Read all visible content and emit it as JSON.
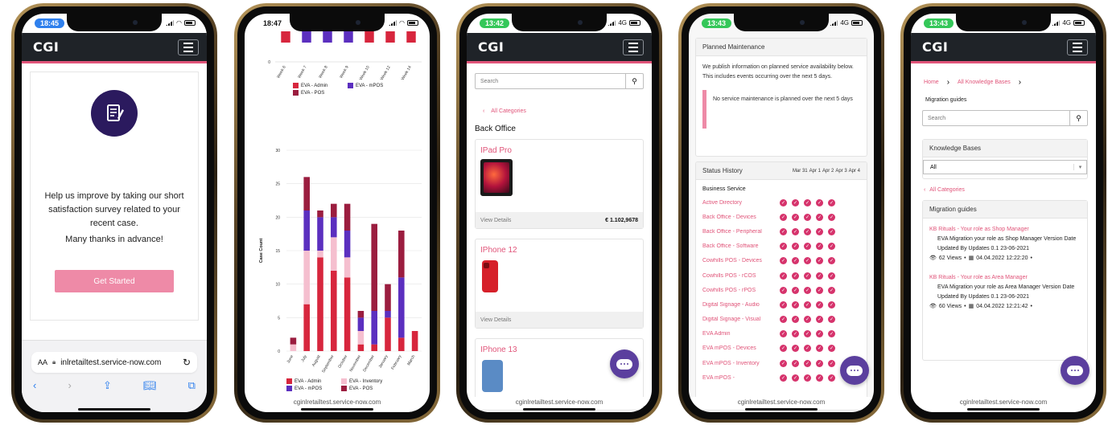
{
  "phones": [
    {
      "time": "18:45",
      "logo": "CGI",
      "survey": {
        "message": "Help us improve by taking our short satisfaction survey related to your recent case.",
        "thanks": "Many thanks in advance!",
        "button": "Get Started"
      },
      "browser": {
        "aa": "AA",
        "url": "inlretailtest.service-now.com"
      },
      "icons": [
        "document-icon",
        "lock-icon",
        "reload-icon",
        "back-arrow-icon",
        "forward-arrow-icon",
        "share-icon",
        "book-icon",
        "tabs-icon"
      ]
    },
    {
      "time": "18:47",
      "footer_url": "cginlretailtest.service-now.com"
    },
    {
      "time": "13:42",
      "network": "4G",
      "logo": "CGI",
      "search_placeholder": "Search",
      "back_link": "All Categories",
      "section_title": "Back Office",
      "items": [
        {
          "name": "IPad Pro",
          "view_details": "View Details",
          "price": "€ 1.102,9678"
        },
        {
          "name": "IPhone 12",
          "view_details": "View Details",
          "price": ""
        },
        {
          "name": "IPhone 13"
        }
      ],
      "footer_url": "cginlretailtest.service-now.com"
    },
    {
      "time": "13:43",
      "network": "4G",
      "planned": {
        "title": "Planned Maintenance",
        "text": "We publish information on planned service availability below. This includes events occurring over the next 5 days.",
        "notice": "No service maintenance is planned over the next 5 days"
      },
      "status": {
        "title": "Status History",
        "dates": [
          "Mar 31",
          "Apr 1",
          "Apr 2",
          "Apr 3",
          "Apr 4"
        ],
        "group": "Business Service",
        "services": [
          "Active Directory",
          "Back Office - Devices",
          "Back Office - Peripheral",
          "Back Office - Software",
          "Cowhills POS - Devices",
          "Cowhills POS - rCOS",
          "Cowhills POS - rPOS",
          "Digital Signage - Audio",
          "Digital Signage - Visual",
          "EVA Admin",
          "EVA mPOS - Devices",
          "EVA mPOS - Inventory",
          "EVA mPOS -"
        ]
      },
      "footer_url": "cginlretailtest.service-now.com"
    },
    {
      "time": "13:43",
      "network": "4G",
      "logo": "CGI",
      "breadcrumb": [
        "Home",
        "All Knowledge Bases"
      ],
      "page_title": "Migration guides",
      "search_placeholder": "Search",
      "kb_panel_title": "Knowledge Bases",
      "kb_select": "All",
      "back_link": "All Categories",
      "guides_title": "Migration guides",
      "articles": [
        {
          "title": "KB Rituals - Your role as Shop Manager",
          "summary": "EVA Migration your role as Shop Manager Version Date Updated By Updates 0.1 23-06-2021",
          "views": "62 Views",
          "date": "04.04.2022 12:22:20"
        },
        {
          "title": "KB Rituals - Your role as Area Manager",
          "summary": "EVA Migration your role as Area Manager Version Date Updated By Updates 0.1 23-06-2021",
          "views": "60 Views",
          "date": "04.04.2022 12:21:42"
        }
      ],
      "footer_url": "cginlretailtest.service-now.com"
    }
  ],
  "chart_data": [
    {
      "type": "bar",
      "categories": [
        "Week 6",
        "Week 7",
        "Week 8",
        "Week 9",
        "Week 10",
        "Week 12",
        "Week 14"
      ],
      "series": [
        {
          "name": "EVA - Admin",
          "color": "#d7263d",
          "values": [
            null,
            null,
            null,
            null,
            null,
            null,
            null
          ]
        },
        {
          "name": "EVA - mPOS",
          "color": "#5b2fbf",
          "values": [
            null,
            null,
            null,
            null,
            null,
            null,
            null
          ]
        },
        {
          "name": "EVA - POS",
          "color": "#9b1d3f",
          "values": [
            null,
            null,
            null,
            null,
            null,
            null,
            null
          ]
        }
      ],
      "bar_colors": [
        "#d7263d",
        "#5b2fbf",
        "#5b2fbf",
        "#5b2fbf",
        "#d7263d",
        "#d7263d",
        "#d7263d"
      ],
      "y_visible_tick": "0",
      "legend": "bottom"
    },
    {
      "type": "bar",
      "stacked": true,
      "ylabel": "Case Count",
      "ylim": [
        0,
        30
      ],
      "yticks": [
        "0",
        "5",
        "10",
        "15",
        "20",
        "25",
        "30"
      ],
      "categories": [
        "June",
        "July",
        "August",
        "September",
        "October",
        "November",
        "December",
        "January",
        "February",
        "March"
      ],
      "series": [
        {
          "name": "EVA - Admin",
          "color": "#d7263d",
          "values": [
            0,
            7,
            14,
            12,
            11,
            1,
            1,
            5,
            2,
            3
          ]
        },
        {
          "name": "EVA - Inventory",
          "color": "#f5bfcf",
          "values": [
            1,
            8,
            1,
            5,
            3,
            2,
            0,
            0,
            0,
            0
          ]
        },
        {
          "name": "EVA - mPOS",
          "color": "#5b2fbf",
          "values": [
            0,
            6,
            5,
            3,
            4,
            2,
            5,
            1,
            9,
            0
          ]
        },
        {
          "name": "EVA - POS",
          "color": "#9b1d3f",
          "values": [
            1,
            5,
            1,
            2,
            4,
            1,
            13,
            4,
            7,
            0
          ]
        }
      ],
      "legend": "bottom"
    }
  ],
  "colors": {
    "accent": "#e05479",
    "header": "#1f2328",
    "chat": "#5b3f9e"
  }
}
